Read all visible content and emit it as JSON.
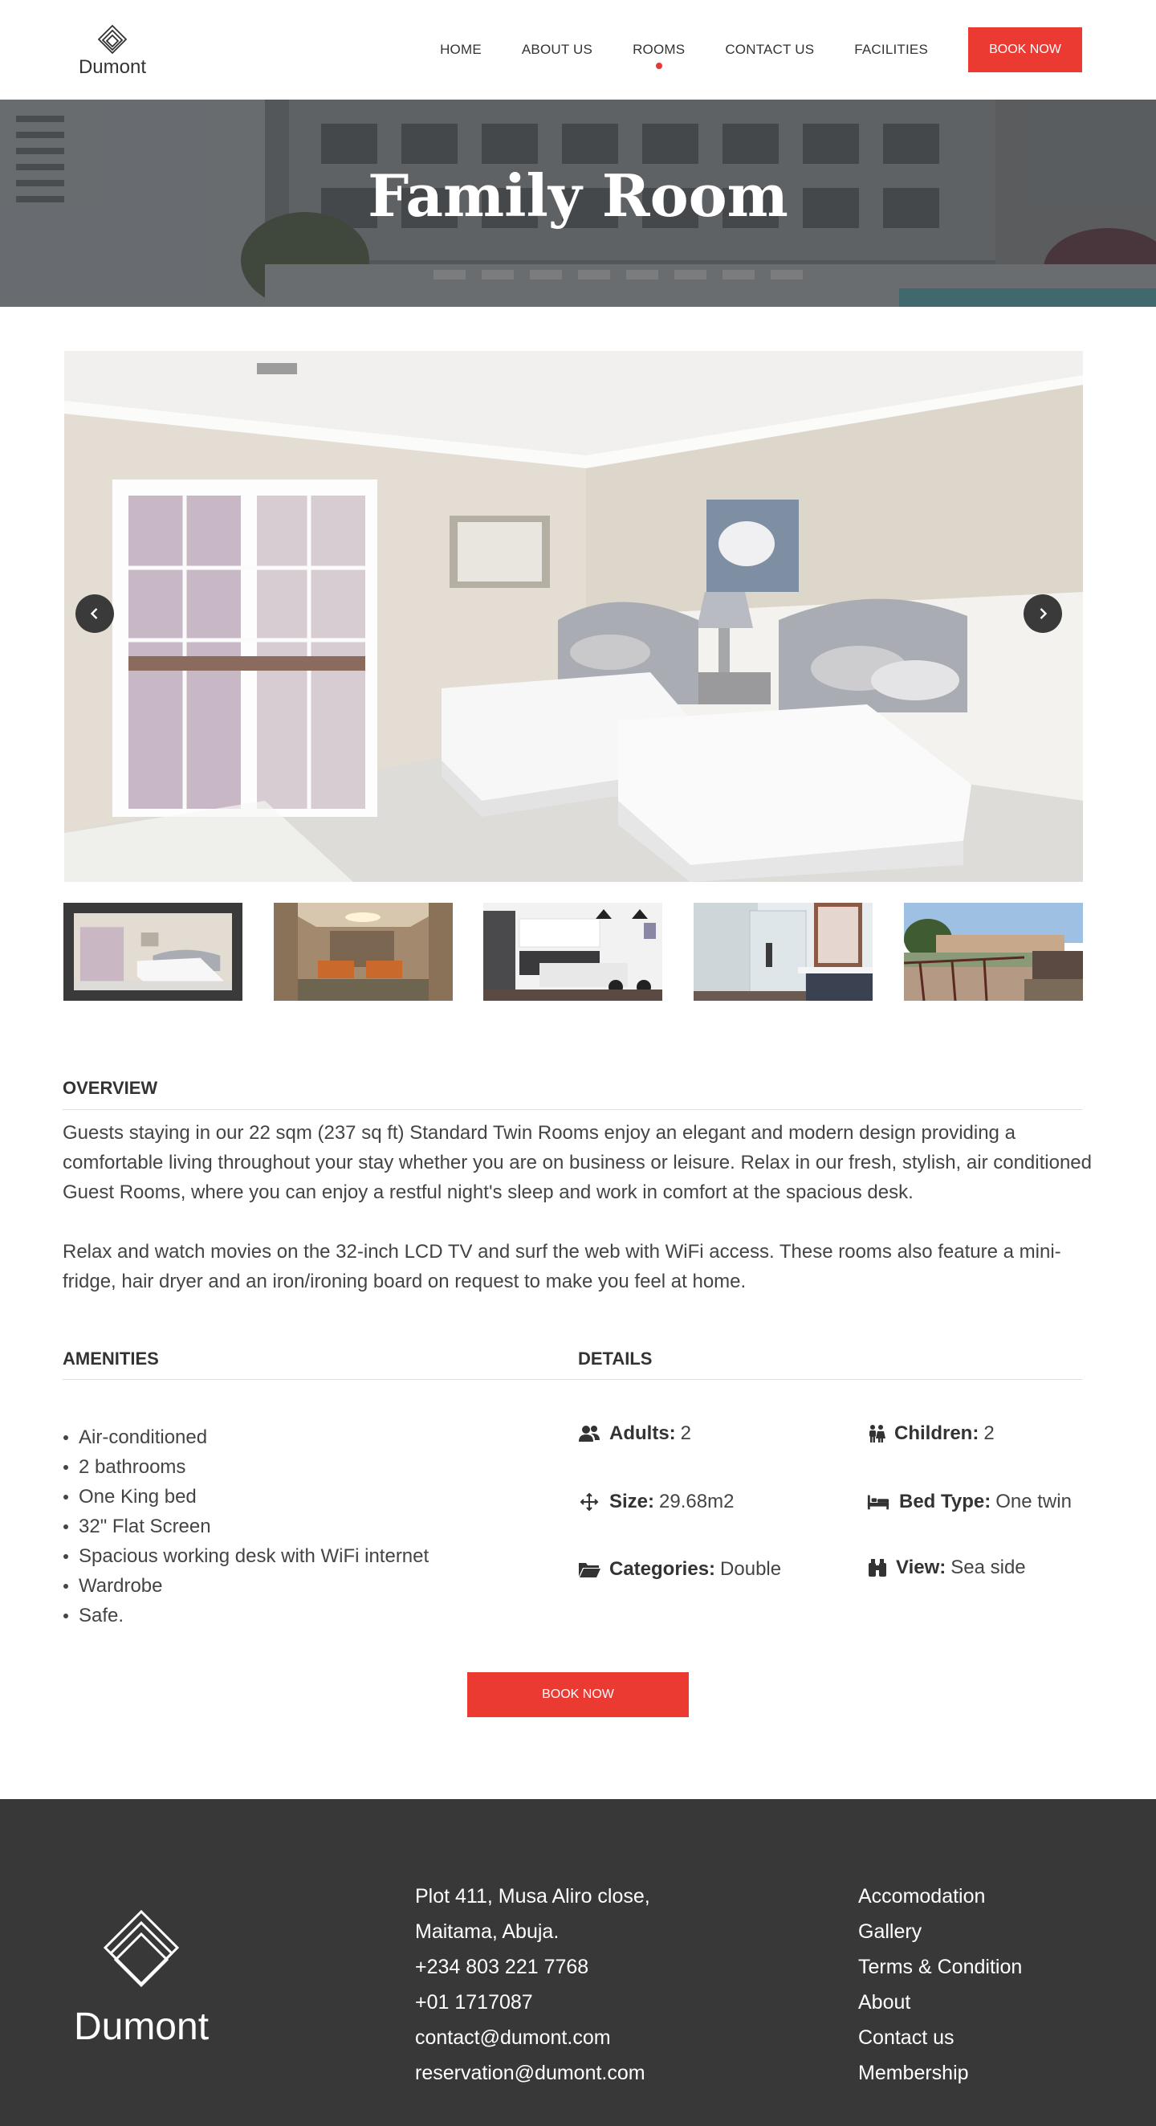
{
  "brand": {
    "name": "Dumont"
  },
  "nav": {
    "items": [
      {
        "label": "HOME",
        "active": false
      },
      {
        "label": "ABOUT US",
        "active": false
      },
      {
        "label": "ROOMS",
        "active": true
      },
      {
        "label": "CONTACT US",
        "active": false
      },
      {
        "label": "FACILITIES",
        "active": false
      }
    ],
    "book_label": "BOOK NOW"
  },
  "hero": {
    "title": "Family Room"
  },
  "gallery": {
    "thumbnails": [
      "bedroom",
      "lobby",
      "kitchen",
      "bathroom",
      "balcony"
    ],
    "active_index": 0
  },
  "overview": {
    "title": "OVERVIEW",
    "paragraphs": [
      "Guests staying in our 22 sqm (237 sq ft) Standard Twin Rooms enjoy an elegant and modern design providing a comfortable living throughout your stay whether you are on business or leisure. Relax in our fresh, stylish, air conditioned Guest Rooms, where you can enjoy a restful night's sleep and work in comfort at the spacious desk.",
      "Relax and watch movies on the 32-inch LCD TV and surf the web with WiFi access. These rooms also feature a mini-fridge, hair dryer and an iron/ironing board on request to make you feel at home."
    ]
  },
  "amenities": {
    "title": "AMENITIES",
    "items": [
      "Air-conditioned",
      "2 bathrooms",
      "One King bed",
      "32\" Flat Screen",
      "Spacious working desk with WiFi internet",
      "Wardrobe",
      "Safe."
    ]
  },
  "details": {
    "title": "DETAILS",
    "adults": {
      "label": "Adults:",
      "value": "2",
      "icon": "users-icon"
    },
    "children": {
      "label": "Children:",
      "value": "2",
      "icon": "child-icon"
    },
    "size": {
      "label": "Size:",
      "value": "29.68m2",
      "icon": "arrows-icon"
    },
    "bed_type": {
      "label": "Bed Type:",
      "value": "One twin",
      "icon": "bed-icon"
    },
    "categories": {
      "label": "Categories:",
      "value": "Double",
      "icon": "folder-icon"
    },
    "view": {
      "label": "View:",
      "value": "Sea side",
      "icon": "binoculars-icon"
    }
  },
  "cta": {
    "book_label": "BOOK NOW"
  },
  "footer": {
    "brand": "Dumont",
    "contact": [
      "Plot 411, Musa Aliro close,",
      "Maitama, Abuja.",
      "+234 803 221 7768",
      "+01 1717087",
      "contact@dumont.com",
      "reservation@dumont.com"
    ],
    "links": [
      "Accomodation",
      "Gallery",
      "Terms & Condition",
      "About",
      "Contact us",
      "Membership"
    ]
  },
  "colors": {
    "accent": "#ea3a32",
    "footer_bg": "#383838",
    "text": "#3a3a3a"
  }
}
